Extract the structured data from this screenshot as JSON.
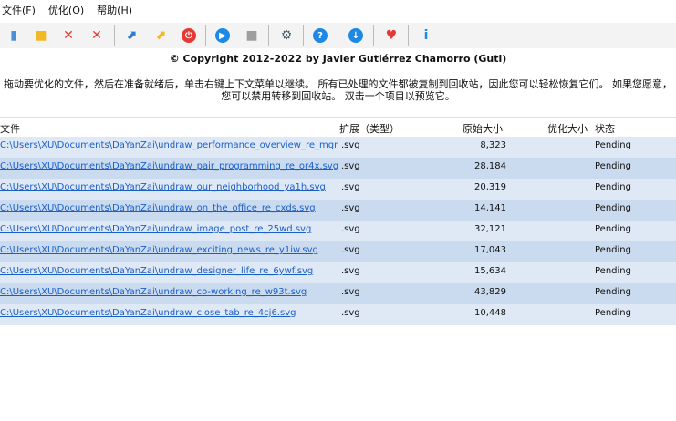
{
  "menu": [
    "文件(F)",
    "优化(O)",
    "帮助(H)"
  ],
  "toolbar": [
    {
      "icon": "add-file-icon",
      "color": "#4a90d9"
    },
    {
      "icon": "add-folder-icon",
      "color": "#f2b824"
    },
    {
      "icon": "remove-selected-icon",
      "color": "#e53935"
    },
    {
      "icon": "clear-all-icon",
      "color": "#e53935"
    },
    {
      "icon": "export-icon",
      "color": "#2a7bd6"
    },
    {
      "icon": "open-folder-icon",
      "color": "#f2b824"
    },
    {
      "icon": "power-icon",
      "color": "#e53935"
    },
    {
      "icon": "play-icon",
      "color": "#1e88e5"
    },
    {
      "icon": "stop-icon",
      "color": "#9e9e9e"
    },
    {
      "icon": "settings-icon",
      "color": "#455a64"
    },
    {
      "icon": "help-icon",
      "color": "#1e88e5"
    },
    {
      "icon": "update-icon",
      "color": "#1e88e5"
    },
    {
      "icon": "heart-icon",
      "color": "#e53935"
    },
    {
      "icon": "info-icon",
      "color": "#1e88e5"
    }
  ],
  "copyright": "© Copyright 2012-2022 by Javier Gutiérrez Chamorro (Guti)",
  "description": "拖动要优化的文件，然后在准备就绪后，单击右键上下文菜单以继续。 所有已处理的文件都被复制到回收站，因此您可以轻松恢复它们。 如果您愿意，您可以禁用转移到回收站。 双击一个项目以预览它。",
  "columns": {
    "file": "文件",
    "ext": "扩展（类型）",
    "orig": "原始大小",
    "opt": "优化大小",
    "status": "状态"
  },
  "rows": [
    {
      "file": "C:\\Users\\XU\\Documents\\DaYanZai\\undraw_performance_overview_re_mgrg.svg",
      "ext": ".svg",
      "orig": "8,323",
      "opt": "",
      "status": "Pending"
    },
    {
      "file": "C:\\Users\\XU\\Documents\\DaYanZai\\undraw_pair_programming_re_or4x.svg",
      "ext": ".svg",
      "orig": "28,184",
      "opt": "",
      "status": "Pending"
    },
    {
      "file": "C:\\Users\\XU\\Documents\\DaYanZai\\undraw_our_neighborhood_ya1h.svg",
      "ext": ".svg",
      "orig": "20,319",
      "opt": "",
      "status": "Pending"
    },
    {
      "file": "C:\\Users\\XU\\Documents\\DaYanZai\\undraw_on_the_office_re_cxds.svg",
      "ext": ".svg",
      "orig": "14,141",
      "opt": "",
      "status": "Pending"
    },
    {
      "file": "C:\\Users\\XU\\Documents\\DaYanZai\\undraw_image_post_re_25wd.svg",
      "ext": ".svg",
      "orig": "32,121",
      "opt": "",
      "status": "Pending"
    },
    {
      "file": "C:\\Users\\XU\\Documents\\DaYanZai\\undraw_exciting_news_re_y1iw.svg",
      "ext": ".svg",
      "orig": "17,043",
      "opt": "",
      "status": "Pending"
    },
    {
      "file": "C:\\Users\\XU\\Documents\\DaYanZai\\undraw_designer_life_re_6ywf.svg",
      "ext": ".svg",
      "orig": "15,634",
      "opt": "",
      "status": "Pending"
    },
    {
      "file": "C:\\Users\\XU\\Documents\\DaYanZai\\undraw_co-working_re_w93t.svg",
      "ext": ".svg",
      "orig": "43,829",
      "opt": "",
      "status": "Pending"
    },
    {
      "file": "C:\\Users\\XU\\Documents\\DaYanZai\\undraw_close_tab_re_4cj6.svg",
      "ext": ".svg",
      "orig": "10,448",
      "opt": "",
      "status": "Pending"
    }
  ]
}
